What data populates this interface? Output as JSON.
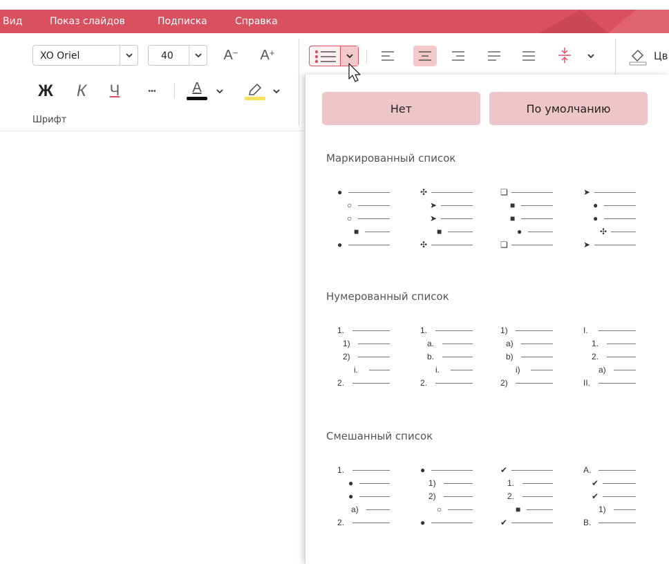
{
  "menu": [
    "Вид",
    "Показ слайдов",
    "Подписка",
    "Справка"
  ],
  "font": {
    "name": "XO Oriel",
    "size": "40",
    "group_label": "Шрифт",
    "bold": "Ж",
    "italic": "К",
    "underline": "Ч",
    "more": "•••",
    "grow": "A",
    "shrink": "A",
    "color_letter": "A"
  },
  "right_label": "Цв",
  "colors": {
    "accent": "#d9505f",
    "button_bg": "#ecc6c8",
    "highlight": "#f5e25a"
  },
  "panel": {
    "none_label": "Нет",
    "default_label": "По умолчанию",
    "bulleted_title": "Маркированный список",
    "numbered_title": "Нумерованный список",
    "mixed_title": "Смешанный список"
  },
  "bulleted": [
    [
      "●",
      "○",
      "○",
      "■",
      "●"
    ],
    [
      "✣",
      "➤",
      "➤",
      "■",
      "✣"
    ],
    [
      "❏",
      "■",
      "■",
      "●",
      "❏"
    ],
    [
      "➤",
      "●",
      "●",
      "✣",
      "➤"
    ]
  ],
  "numbered": [
    [
      "1.",
      "1)",
      "2)",
      "i.",
      "2."
    ],
    [
      "1.",
      "a.",
      "b.",
      "i.",
      "2."
    ],
    [
      "1)",
      "a)",
      "b)",
      "i)",
      "2)"
    ],
    [
      "I.",
      "1.",
      "2.",
      "a)",
      "II."
    ]
  ],
  "mixed": [
    [
      "1.",
      "●",
      "●",
      "a)",
      "2."
    ],
    [
      "●",
      "1)",
      "2)",
      "○",
      "●"
    ],
    [
      "✔",
      "1.",
      "2.",
      "■",
      "✔"
    ],
    [
      "A.",
      "✔",
      "✔",
      "1)",
      "B."
    ]
  ]
}
